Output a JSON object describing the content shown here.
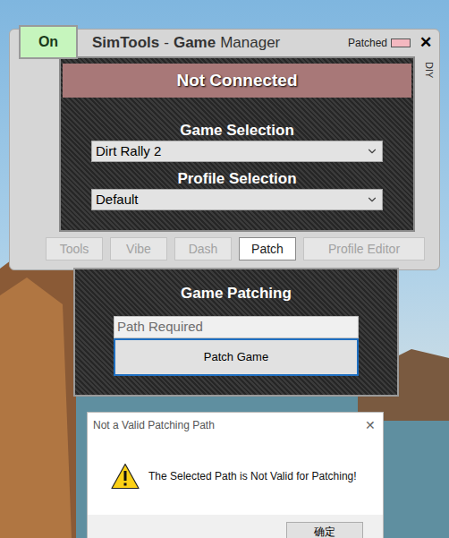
{
  "main_window": {
    "power_button": {
      "label": "On",
      "on": true
    },
    "title": {
      "brand": "SimTools",
      "separator": "-",
      "emphasis": "Game",
      "rest": "Manager"
    },
    "patched": {
      "label": "Patched",
      "on": false
    },
    "close": "✕",
    "side_tab": "DIY"
  },
  "status": {
    "text": "Not Connected",
    "connected": false
  },
  "game_selection": {
    "label": "Game Selection",
    "value": "Dirt Rally 2"
  },
  "profile_selection": {
    "label": "Profile Selection",
    "value": "Default"
  },
  "tabs": [
    {
      "label": "Tools",
      "selected": false
    },
    {
      "label": "Vibe",
      "selected": false
    },
    {
      "label": "Dash",
      "selected": false
    },
    {
      "label": "Patch",
      "selected": true
    },
    {
      "label": "Profile Editor",
      "selected": false
    }
  ],
  "patch_panel": {
    "title": "Game Patching",
    "path_placeholder": "Path Required",
    "button": "Patch Game",
    "button_focused": true
  },
  "dialog": {
    "title": "Not a Valid Patching Path",
    "close": "✕",
    "message": "The Selected Path is Not Valid for Patching!",
    "buttons": [
      "确定"
    ]
  }
}
